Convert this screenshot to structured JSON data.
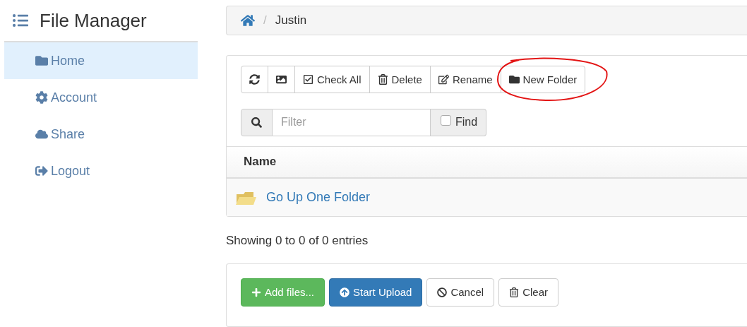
{
  "sidebar": {
    "title": "File Manager",
    "items": [
      {
        "label": "Home",
        "selected": true
      },
      {
        "label": "Account",
        "selected": false
      },
      {
        "label": "Share",
        "selected": false
      },
      {
        "label": "Logout",
        "selected": false
      }
    ]
  },
  "breadcrumb": {
    "separator": "/",
    "items": [
      "Justin"
    ]
  },
  "toolbar": {
    "buttons": [
      {
        "kind": "refresh"
      },
      {
        "kind": "image"
      },
      {
        "kind": "check",
        "label": "Check All"
      },
      {
        "kind": "delete",
        "label": "Delete"
      },
      {
        "kind": "rename",
        "label": "Rename"
      },
      {
        "kind": "folder",
        "label": "New Folder"
      }
    ],
    "filter": {
      "placeholder": "Filter"
    },
    "find": {
      "label": "Find",
      "checked": false
    }
  },
  "table": {
    "columns": [
      "Name"
    ],
    "rows": [
      {
        "name": "Go Up One Folder"
      }
    ]
  },
  "info": "Showing 0 to 0 of 0 entries",
  "upload_buttons": [
    {
      "kind": "add",
      "label": "Add files..."
    },
    {
      "kind": "start",
      "label": "Start Upload"
    },
    {
      "kind": "cancel",
      "label": "Cancel"
    },
    {
      "kind": "clear",
      "label": "Clear"
    }
  ]
}
